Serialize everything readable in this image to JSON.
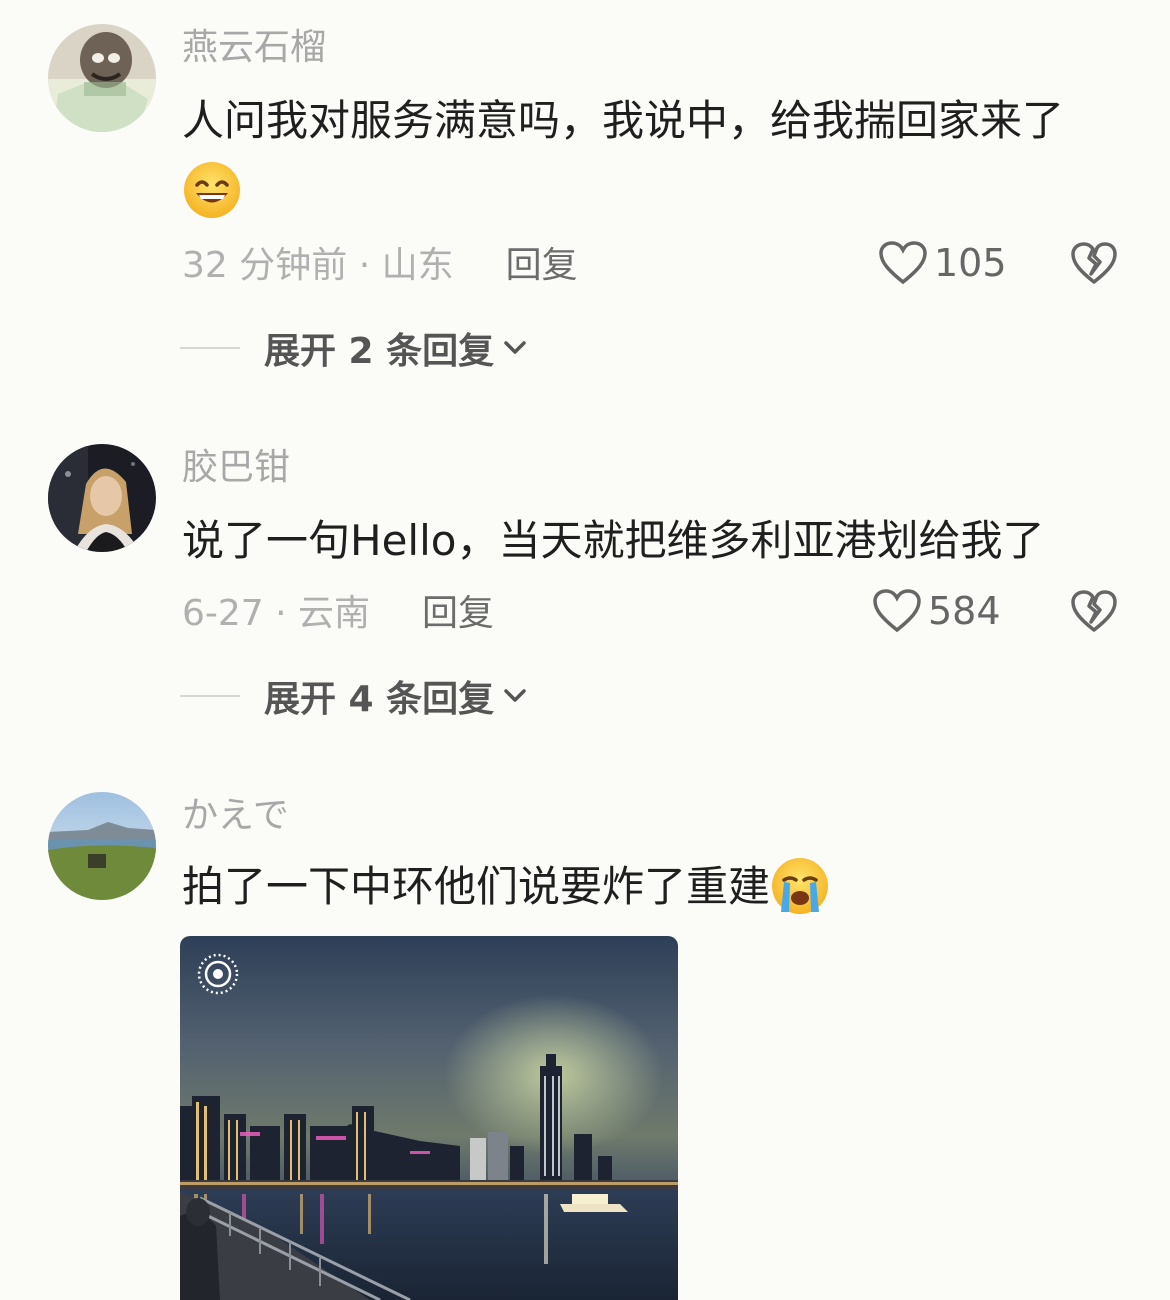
{
  "comments": [
    {
      "username": "燕云石榴",
      "text": "人问我对服务满意吗，我说中，给我揣回家来了",
      "meta": "32 分钟前 · 山东",
      "reply_label": "回复",
      "likes": "105",
      "expand_label": "展开 2 条回复",
      "emoji": "grinning-sweat-emoji"
    },
    {
      "username": "胶巴钳",
      "text": "说了一句Hello，当天就把维多利亚港划给我了",
      "meta": "6-27 · 云南",
      "reply_label": "回复",
      "likes": "584",
      "expand_label": "展开 4 条回复"
    },
    {
      "username": "かえで",
      "text": "拍了一下中环他们说要炸了重建",
      "emoji": "loudly-crying-emoji",
      "image": "hong-kong-skyline-night-photo",
      "image_badge": "live-photo-icon"
    }
  ],
  "colors": {
    "background": "#fbfbf8",
    "username": "#a8a8a8",
    "text": "#1f1f1f",
    "meta": "#b0b0b0",
    "reply": "#6c6c6c"
  }
}
